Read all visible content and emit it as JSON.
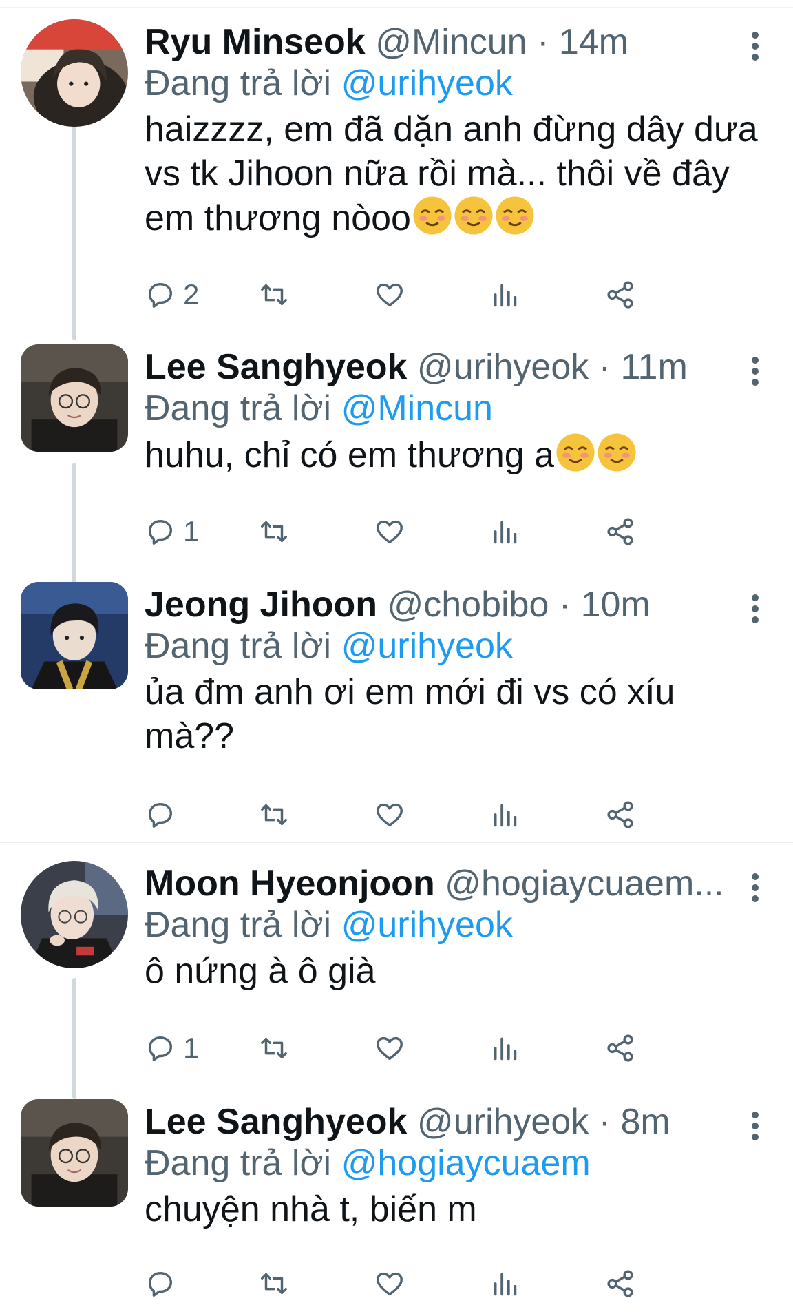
{
  "tweets": [
    {
      "name": "Ryu Minseok",
      "handle": "@Mincun",
      "time": "14m",
      "reply_prefix": "Đang trả lời",
      "reply_to": "@urihyeok",
      "text": "haizzzz, em đã dặn anh đừng dây dưa vs tk Jihoon nữa rồi mà... thôi về đây em thương nòoo",
      "emoji": [
        "smiling-face-emoji",
        "smiling-face-emoji",
        "smiling-face-emoji"
      ],
      "reply_count": "2"
    },
    {
      "name": "Lee Sanghyeok",
      "handle": "@urihyeok",
      "time": "11m",
      "reply_prefix": "Đang trả lời",
      "reply_to": "@Mincun",
      "text": "huhu, chỉ có em thương a",
      "emoji": [
        "smiling-face-emoji",
        "smiling-face-emoji"
      ],
      "reply_count": "1"
    },
    {
      "name": "Jeong Jihoon",
      "handle": "@chobibo",
      "time": "10m",
      "reply_prefix": "Đang trả lời",
      "reply_to": "@urihyeok",
      "text": "ủa đm anh ơi em mới đi vs có xíu mà??",
      "reply_count": ""
    },
    {
      "name": "Moon Hyeonjoon",
      "handle": "@hogiaycuaem...",
      "time": "",
      "reply_prefix": "Đang trả lời",
      "reply_to": "@urihyeok",
      "text": "ô nứng à ô già",
      "reply_count": "1"
    },
    {
      "name": "Lee Sanghyeok",
      "handle": "@urihyeok",
      "time": "8m",
      "reply_prefix": "Đang trả lời",
      "reply_to": "@hogiaycuaem",
      "text": "chuyện nhà t, biến m",
      "reply_count": ""
    }
  ],
  "icons": {
    "reply": "reply-icon",
    "retweet": "retweet-icon",
    "like": "heart-icon",
    "views": "analytics-icon",
    "share": "share-icon",
    "more": "more-options-icon"
  },
  "colors": {
    "link": "#1d9bf0",
    "muted": "#536471",
    "text": "#0f1419",
    "thread_line": "#cfd9de"
  }
}
